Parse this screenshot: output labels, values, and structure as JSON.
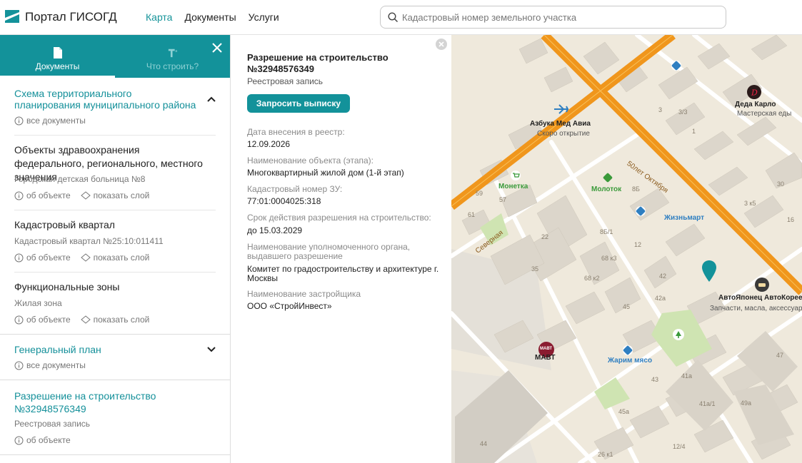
{
  "header": {
    "brand": "Портал ГИСОГД",
    "nav": [
      {
        "label": "Карта",
        "active": true
      },
      {
        "label": "Документы",
        "active": false
      },
      {
        "label": "Услуги",
        "active": false
      }
    ],
    "search_placeholder": "Кадастровый номер земельного участка"
  },
  "left_panel": {
    "tabs": [
      {
        "label": "Документы",
        "icon": "document-icon",
        "active": true
      },
      {
        "label": "Что строить?",
        "icon": "text-format-icon",
        "active": false
      }
    ],
    "sections": {
      "territorial": {
        "title": "Схема территориального планирования муниципального района",
        "all_docs": "все документы",
        "expanded": true,
        "items": [
          {
            "title": "Объекты здравоохранения федерального, регионального, местного значения",
            "subtitle": "Городская детская больница №8",
            "about": "об объекте",
            "show_layer": "показать слой"
          },
          {
            "title": "Кадастровый квартал",
            "subtitle": "Кадастровый квартал №25:10:011411",
            "about": "об объекте",
            "show_layer": "показать слой"
          },
          {
            "title": "Функциональные зоны",
            "subtitle": "Жилая зона",
            "about": "об объекте",
            "show_layer": "показать слой"
          }
        ]
      },
      "general_plan": {
        "title": "Генеральный план",
        "all_docs": "все документы",
        "expanded": false
      },
      "permit": {
        "title": "Разрешение на строительство №32948576349",
        "subtitle": "Реестровая запись",
        "about": "об объекте"
      }
    }
  },
  "detail": {
    "title": "Разрешение на строительство №32948576349",
    "subtitle": "Реестровая запись",
    "button": "Запросить выписку",
    "fields": [
      {
        "label": "Дата внесения в реестр:",
        "value": "12.09.2026"
      },
      {
        "label": "Наименование объекта (этапа):",
        "value": "Многоквартирный жилой дом (1-й этап)"
      },
      {
        "label": "Кадастровый номер ЗУ:",
        "value": "77:01:0004025:318"
      },
      {
        "label": "Срок действия разрешения на строительство:",
        "value": "до 15.03.2029"
      },
      {
        "label": "Наименование уполномоченного органа, выдавшего разрешение",
        "value": "Комитет по градостроительству и архитектуре г. Москвы"
      },
      {
        "label": "Наименование застройщика",
        "value": "ООО «СтройИнвест»"
      }
    ]
  },
  "map": {
    "pois": {
      "deda_karlo": {
        "name": "Деда Карло",
        "sub": "Мастерская еды"
      },
      "azbuka": {
        "name": "Азбука Мед Авиа",
        "sub": "Скоро открытие"
      },
      "monetka": {
        "name": "Монетка"
      },
      "molotok": {
        "name": "Молоток"
      },
      "zhiznmart": {
        "name": "Жизньмарт"
      },
      "autojapan": {
        "name": "АвтоЯпонец АвтоКорее",
        "sub": "Запчасти, масла, аксессуары,"
      },
      "mavt": {
        "name": "МАВТ",
        "badge": "МАВТ"
      },
      "zharim": {
        "name": "Жарим мясо"
      }
    },
    "streets": {
      "october": "50лет Октября",
      "severnaya": "Северная"
    },
    "house_numbers": [
      "3",
      "3/3",
      "1",
      "59",
      "57",
      "8Б",
      "30",
      "3 к5",
      "16",
      "61",
      "12",
      "8Б/1",
      "22",
      "68 к3",
      "35",
      "68 к2",
      "42",
      "42а",
      "45",
      "43",
      "41а",
      "41а/1",
      "45а",
      "49а",
      "47",
      "12/4",
      "26 к1",
      "44"
    ],
    "colors": {
      "road": "#f0961c",
      "accent": "#13929a",
      "park": "#cfe4b2"
    }
  }
}
